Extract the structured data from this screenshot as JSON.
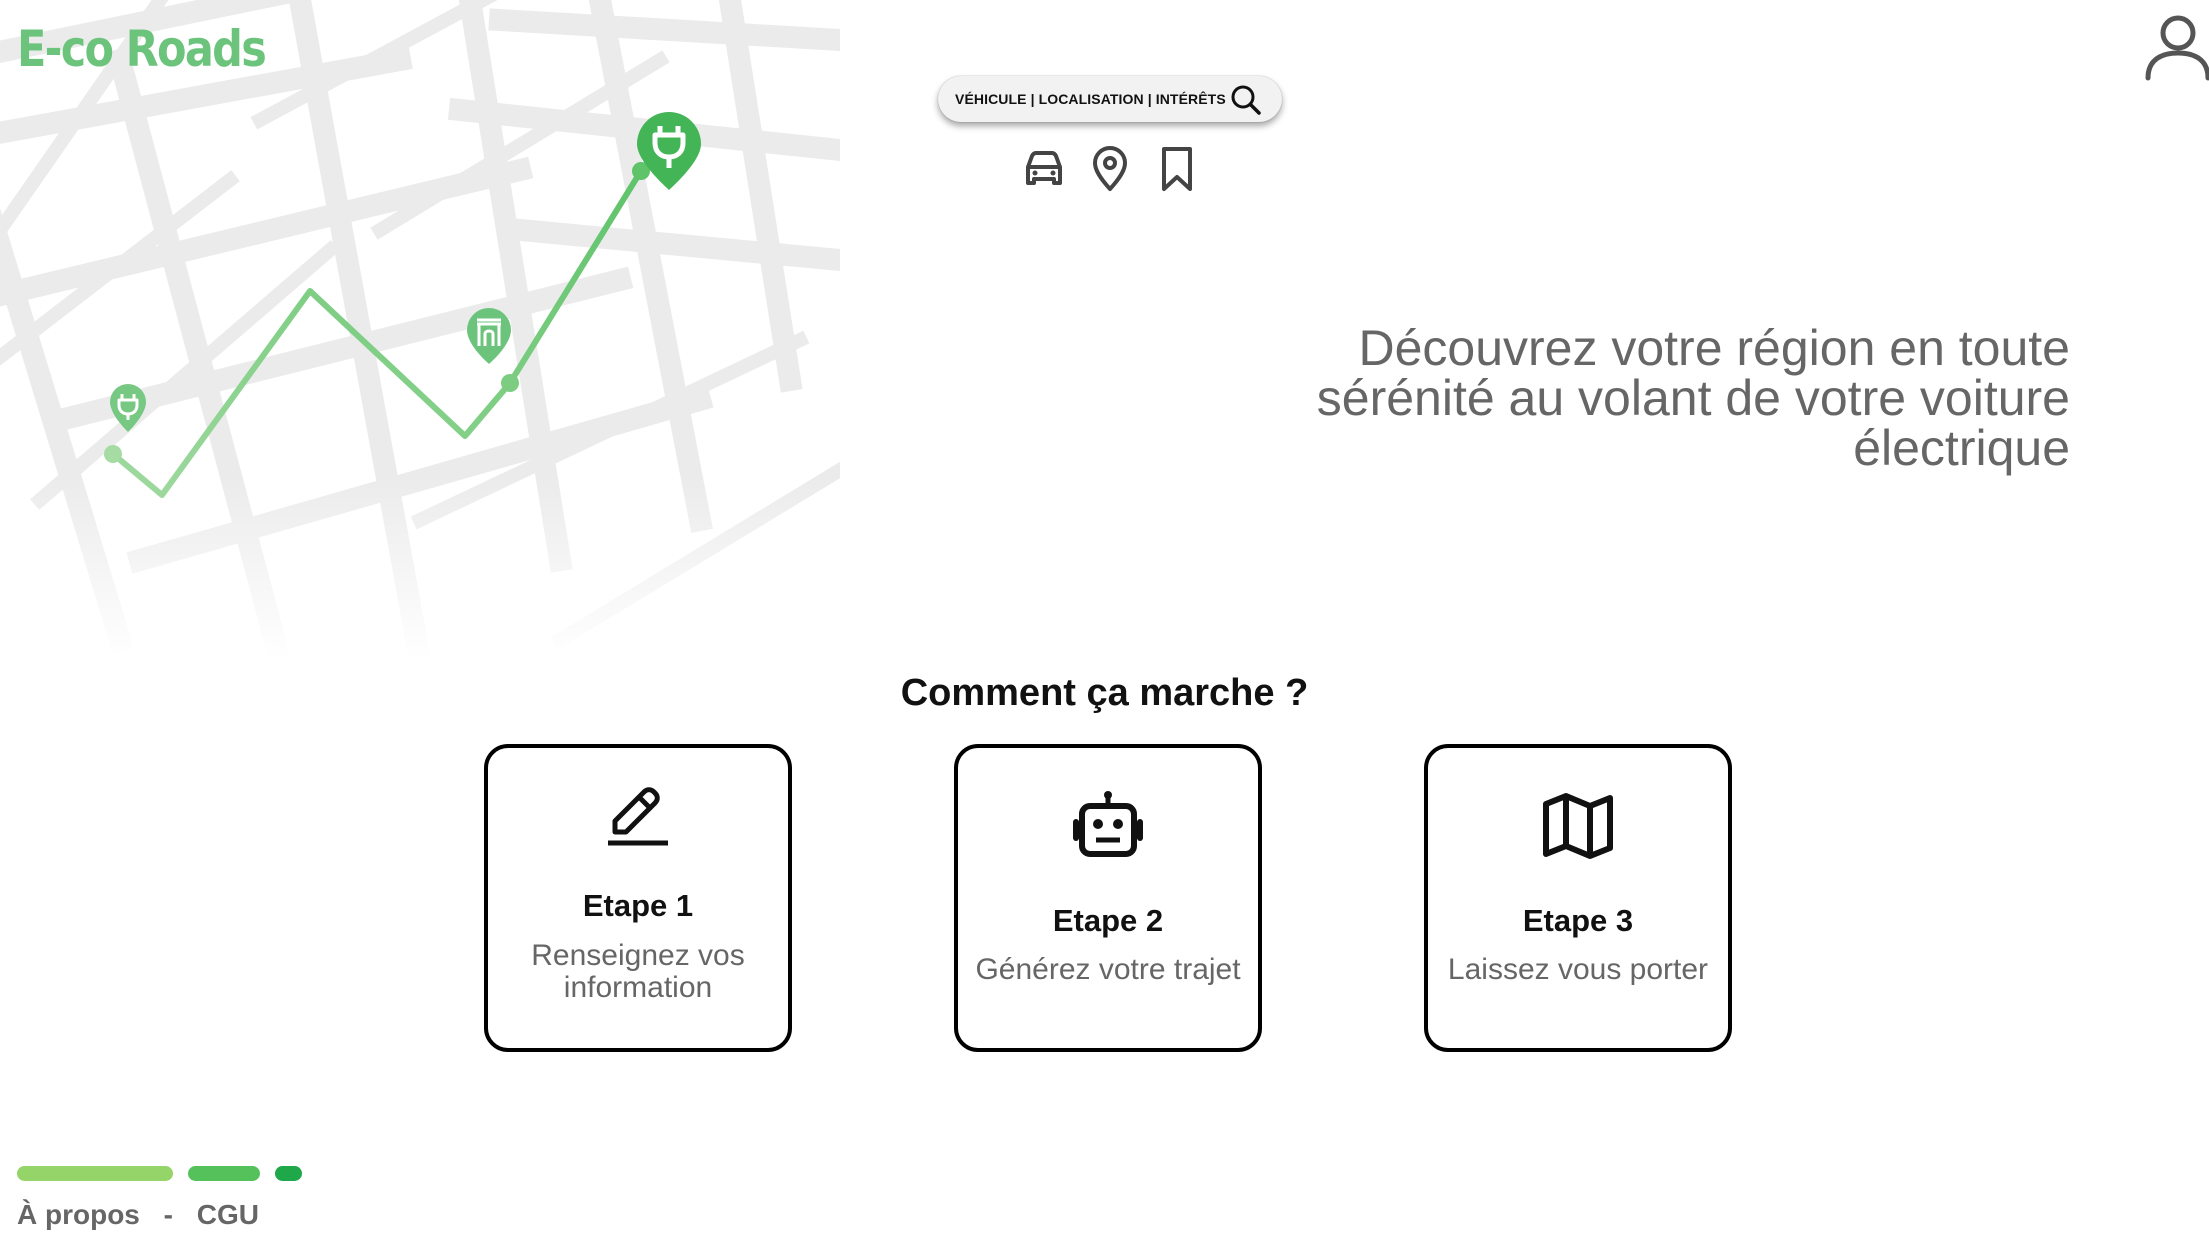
{
  "app": {
    "logo_text": "E-co Roads",
    "accent_color": "#6cc47c",
    "icons": {
      "user": "user-icon",
      "route_marker": "charging-plug-icon",
      "poi_marker": "monument-icon"
    }
  },
  "search": {
    "label": "VÉHICULE | LOCALISATION | INTÉRÊTS",
    "icon": "search-icon"
  },
  "filters": [
    {
      "name": "vehicle",
      "icon": "car-icon"
    },
    {
      "name": "location",
      "icon": "location-pin-icon"
    },
    {
      "name": "interests",
      "icon": "bookmark-icon"
    }
  ],
  "hero": {
    "tagline_line1": "Découvrez votre région en toute",
    "tagline_line2": "sérénité au volant de votre voiture",
    "tagline_line3": "électrique"
  },
  "how_it_works": {
    "title": "Comment ça marche ?",
    "steps": [
      {
        "title": "Etape 1",
        "desc_line1": "Renseignez vos",
        "desc_line2": "information",
        "icon": "pencil-icon"
      },
      {
        "title": "Etape 2",
        "desc_line1": "Générez votre trajet",
        "desc_line2": "",
        "icon": "robot-icon"
      },
      {
        "title": "Etape 3",
        "desc_line1": "Laissez vous porter",
        "desc_line2": "",
        "icon": "map-icon"
      }
    ]
  },
  "progress_bars": [
    {
      "color": "#94d468"
    },
    {
      "color": "#55c15a"
    },
    {
      "color": "#1ea84a"
    }
  ],
  "footer": {
    "about": "À propos",
    "separator": "-",
    "terms": "CGU"
  }
}
